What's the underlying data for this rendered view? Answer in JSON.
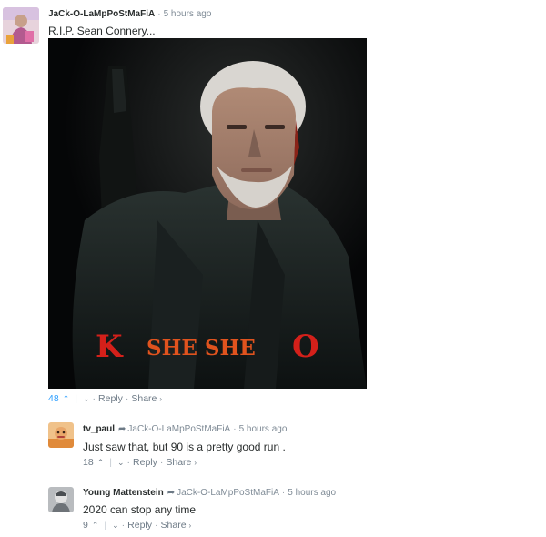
{
  "comments": [
    {
      "author": "JaCk-O-LaMpPoStMaFiA",
      "time": "5 hours ago",
      "text": "R.I.P. Sean Connery...",
      "image": {
        "caption_left": "K",
        "caption_mid": "SHE SHE",
        "caption_right": "O"
      },
      "votes": "48",
      "reply_label": "Reply",
      "share_label": "Share"
    },
    {
      "author": "tv_paul",
      "reply_to": "JaCk-O-LaMpPoStMaFiA",
      "time": "5 hours ago",
      "text": "Just saw that, but 90 is a pretty good run .",
      "votes": "18",
      "reply_label": "Reply",
      "share_label": "Share"
    },
    {
      "author": "Young Mattenstein",
      "reply_to": "JaCk-O-LaMpPoStMaFiA",
      "time": "5 hours ago",
      "text": "2020 can stop any time",
      "votes": "9",
      "reply_label": "Reply",
      "share_label": "Share"
    }
  ],
  "colors": {
    "accent": "#2e9fff",
    "meta": "#7f8b96",
    "caption_red": "#d4201a",
    "caption_orange": "#e0531e"
  },
  "icons": [
    "upvote-icon",
    "downvote-icon",
    "reply-arrow-icon",
    "share-caret-icon"
  ]
}
